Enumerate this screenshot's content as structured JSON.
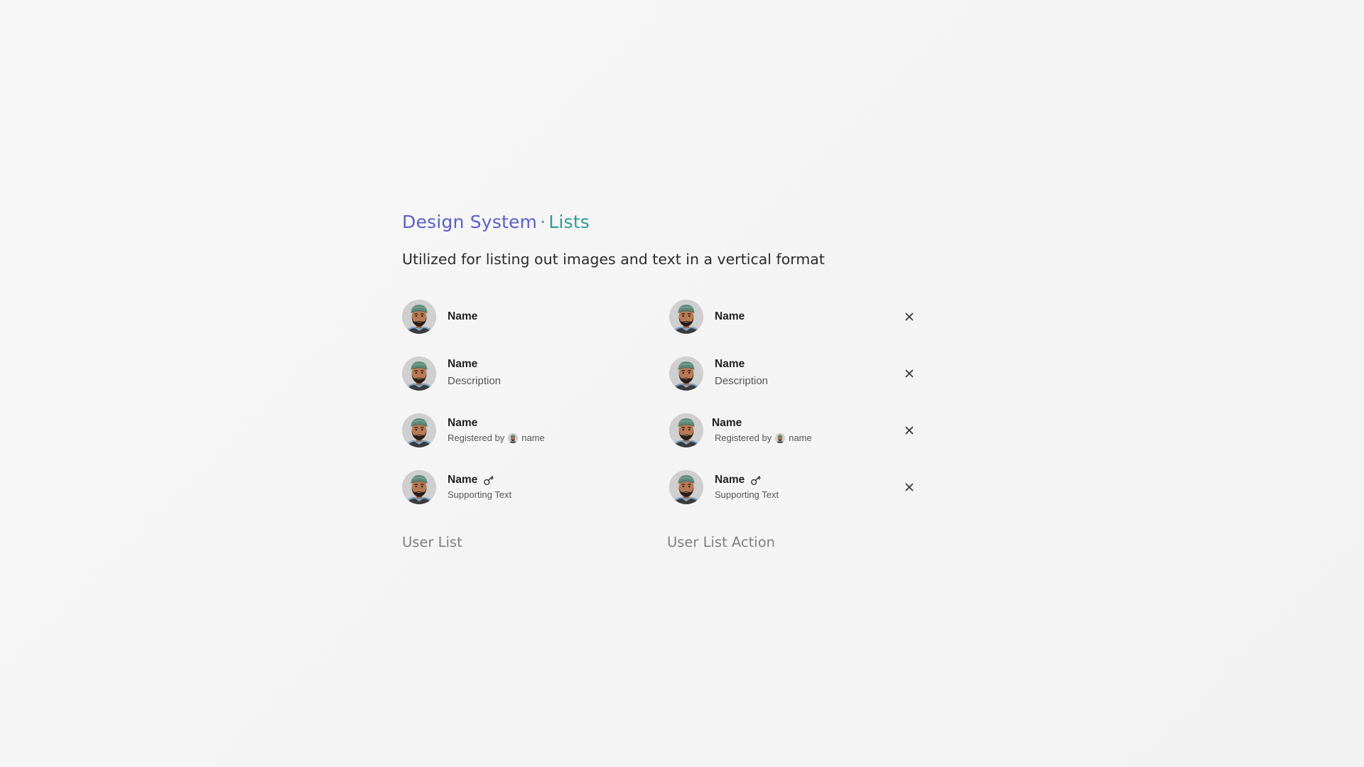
{
  "header": {
    "title_part1": "Design System",
    "title_sep": "·",
    "title_part2": "Lists",
    "subtitle": "Utilized for listing out images and text in a vertical format"
  },
  "user_list": {
    "caption": "User List",
    "items": [
      {
        "name": "Name"
      },
      {
        "name": "Name",
        "description": "Description"
      },
      {
        "name": "Name",
        "registered_label": "Registered by",
        "registered_name": "name"
      },
      {
        "name": "Name",
        "supporting": "Supporting Text",
        "icon": "key-icon"
      }
    ]
  },
  "user_list_action": {
    "caption": "User List Action",
    "items": [
      {
        "name": "Name",
        "action_icon": "close-icon"
      },
      {
        "name": "Name",
        "description": "Description",
        "action_icon": "close-icon"
      },
      {
        "name": "Name",
        "registered_label": "Registered by",
        "registered_name": "name",
        "action_icon": "close-icon"
      },
      {
        "name": "Name",
        "supporting": "Supporting Text",
        "icon": "key-icon",
        "action_icon": "close-icon"
      }
    ]
  },
  "colors": {
    "title_primary": "#5b5fc7",
    "title_secondary": "#2a9d96",
    "caption": "#808080",
    "background": "#f4f4f4"
  }
}
